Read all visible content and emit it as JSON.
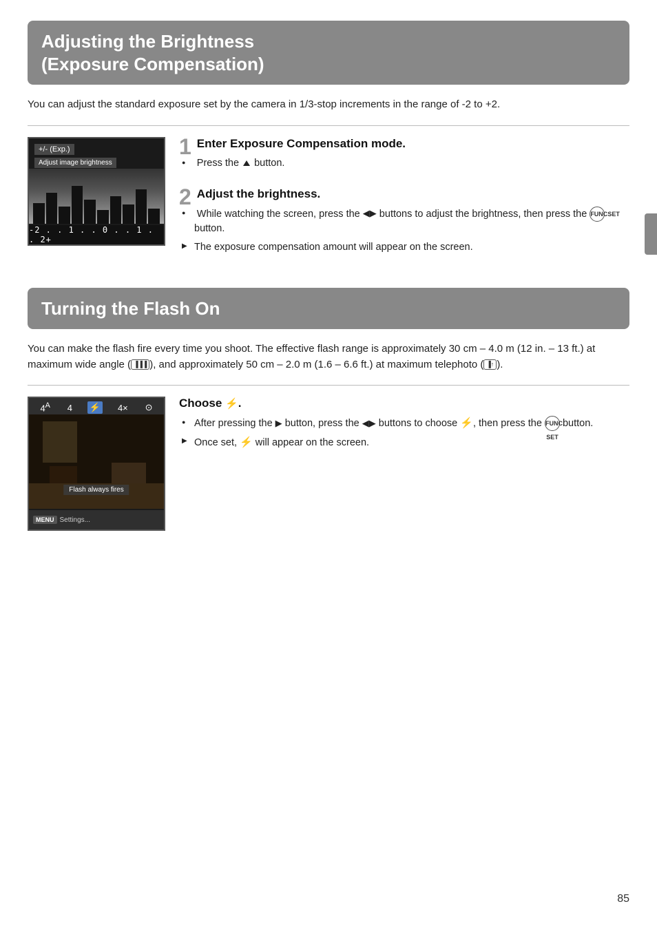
{
  "section1": {
    "title": "Adjusting the Brightness\n(Exposure Compensation)",
    "title_line1": "Adjusting the Brightness",
    "title_line2": "(Exposure Compensation)",
    "intro": "You can adjust the standard exposure set by the camera in 1/3-stop increments in the range of -2 to +2.",
    "camera_exp_label": "+/- (Exp.)",
    "camera_adj_label": "Adjust image brightness",
    "camera_scale": "-2 . . 1 . . 0 . . 1 . . 2+",
    "step1": {
      "number": "1",
      "title": "Enter Exposure Compensation mode.",
      "bullets": [
        {
          "type": "circle",
          "text": "Press the ▲ button."
        }
      ]
    },
    "step2": {
      "number": "2",
      "title": "Adjust the brightness.",
      "bullets": [
        {
          "type": "circle",
          "text": "While watching the screen, press the ◀▶ buttons to adjust the brightness, then press the  button."
        },
        {
          "type": "triangle",
          "text": "The exposure compensation amount will appear on the screen."
        }
      ]
    }
  },
  "section2": {
    "title": "Turning the Flash On",
    "intro": "You can make the flash fire every time you shoot. The effective flash range is approximately 30 cm – 4.0 m (12 in. – 13 ft.) at maximum wide angle (), and approximately 50 cm – 2.0 m (1.6 – 6.6 ft.) at maximum telephoto ().",
    "choose_title": "Choose ⚡.",
    "bullets": [
      {
        "type": "circle",
        "text": "After pressing the ▶ button, press the ◀▶ buttons to choose ⚡, then press the  button."
      },
      {
        "type": "triangle",
        "text": "Once set, ⚡ will appear on the screen."
      }
    ],
    "flash_always_label": "Flash always fires",
    "menu_btn": "MENU",
    "settings_text": "Settings..."
  },
  "page_number": "85"
}
